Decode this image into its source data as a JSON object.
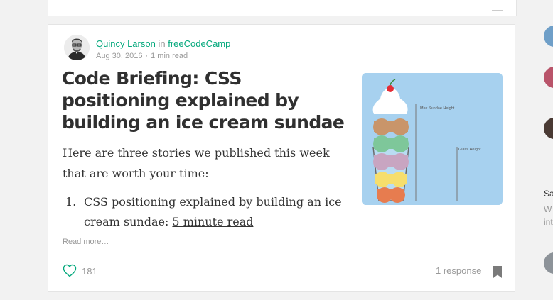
{
  "post": {
    "author": "Quincy Larson",
    "in_label": "in",
    "publication": "freeCodeCamp",
    "date": "Aug 30, 2016",
    "separator": "·",
    "read_time": "1 min read",
    "title": "Code Briefing: CSS positioning explained by building an ice cream sundae",
    "excerpt": "Here are three stories we published this week that are worth your time:",
    "list": [
      {
        "num": "1.",
        "text": "CSS positioning explained by building an ice cream sundae: ",
        "link": "5 minute read"
      }
    ],
    "read_more": "Read more…",
    "claps": "181",
    "responses": "1 response",
    "image": {
      "label_max": "Max Sundae Height",
      "label_glass": "Glass Height"
    }
  },
  "right_rail": {
    "text_1": "Sa",
    "text_2": "W",
    "text_3": "int"
  },
  "colors": {
    "accent": "#03a87c",
    "muted": "#999999",
    "image_bg": "#a7d1ef"
  },
  "icons": [
    "like-heart-icon",
    "bookmark-icon",
    "avatar"
  ]
}
